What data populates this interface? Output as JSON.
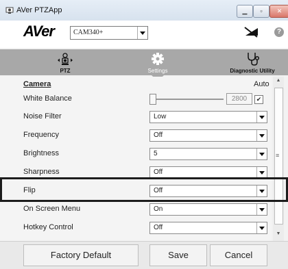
{
  "window": {
    "title": "AVer PTZApp"
  },
  "header": {
    "logo": "AVer",
    "camera_select": "CAM340+",
    "help": "?"
  },
  "nav": {
    "tabs": [
      {
        "label": "PTZ",
        "icon": "ptz-camera-icon"
      },
      {
        "label": "Settings",
        "icon": "gear-icon",
        "active": true
      },
      {
        "label": "Diagnostic Utility",
        "icon": "stethoscope-icon"
      }
    ]
  },
  "settings": {
    "section": "Camera",
    "auto_label": "Auto",
    "white_balance": {
      "label": "White Balance",
      "value": "2800",
      "auto_checked": true,
      "check_mark": "✔"
    },
    "rows": [
      {
        "label": "Noise Filter",
        "value": "Low"
      },
      {
        "label": "Frequency",
        "value": "Off"
      },
      {
        "label": "Brightness",
        "value": "5"
      },
      {
        "label": "Sharpness",
        "value": "Off"
      },
      {
        "label": "Flip",
        "value": "Off"
      },
      {
        "label": "On Screen Menu",
        "value": "On"
      },
      {
        "label": "Hotkey Control",
        "value": "Off"
      }
    ]
  },
  "footer": {
    "factory_default": "Factory Default",
    "save": "Save",
    "cancel": "Cancel"
  },
  "colors": {
    "nav_bg": "#a8a8a8",
    "highlight_border": "#1c1c1c"
  }
}
